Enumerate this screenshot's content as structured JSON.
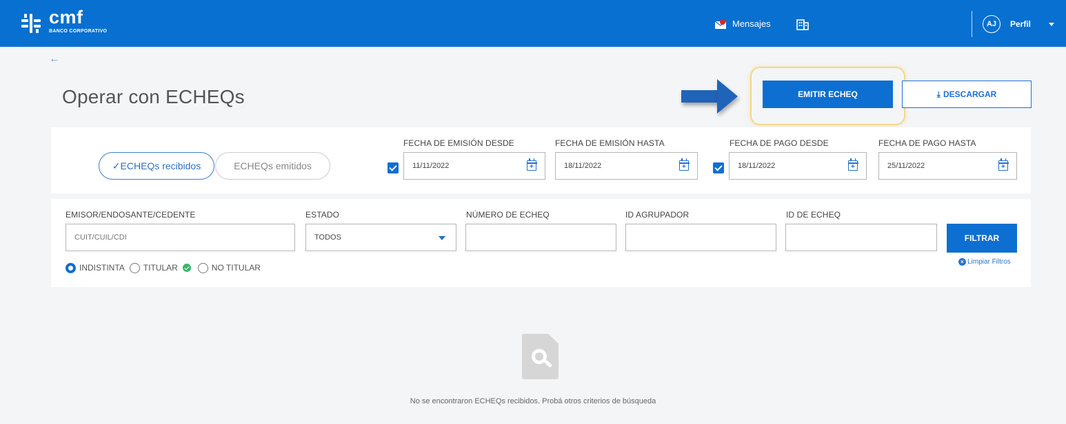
{
  "header": {
    "brand_name": "cmf",
    "brand_subtitle": "BANCO CORPORATIVO",
    "messages_label": "Mensajes",
    "avatar_initials": "AJ",
    "profile_label": "Perfil",
    "color": "#0870d0"
  },
  "page": {
    "back_icon": "←",
    "title": "Operar con ECHEQs",
    "emit_button": "EMITIR ECHEQ",
    "download_button": "DESCARGAR",
    "download_icon": "⤓"
  },
  "tabs": {
    "received": "✓ECHEQs recibidos",
    "issued": "ECHEQs emitidos"
  },
  "date_filters": {
    "emission_from": {
      "label": "FECHA DE EMISIÓN DESDE",
      "value": "11/11/2022",
      "enabled": true
    },
    "emission_to": {
      "label": "FECHA DE EMISIÓN HASTA",
      "value": "18/11/2022"
    },
    "payment_from": {
      "label": "FECHA DE PAGO DESDE",
      "value": "18/11/2022",
      "enabled": true
    },
    "payment_to": {
      "label": "FECHA DE PAGO HASTA",
      "value": "25/11/2022"
    }
  },
  "filters": {
    "issuer": {
      "label": "EMISOR/ENDOSANTE/CEDENTE",
      "placeholder": "CUIT/CUIL/CDI",
      "value": ""
    },
    "status": {
      "label": "ESTADO",
      "selected": "TODOS"
    },
    "echeq_number": {
      "label": "NÚMERO DE ECHEQ",
      "value": ""
    },
    "group_id": {
      "label": "ID AGRUPADOR",
      "value": ""
    },
    "echeq_id": {
      "label": "ID DE ECHEQ",
      "value": ""
    },
    "filter_button": "FILTRAR",
    "clear_filters": "Limpiar Filtros",
    "ownership": {
      "selected": "INDISTINTA",
      "options": [
        "INDISTINTA",
        "TITULAR",
        "NO TITULAR"
      ]
    }
  },
  "empty_state": {
    "message": "No se encontraron ECHEQs recibidos. Probá otros criterios de búsqueda"
  }
}
